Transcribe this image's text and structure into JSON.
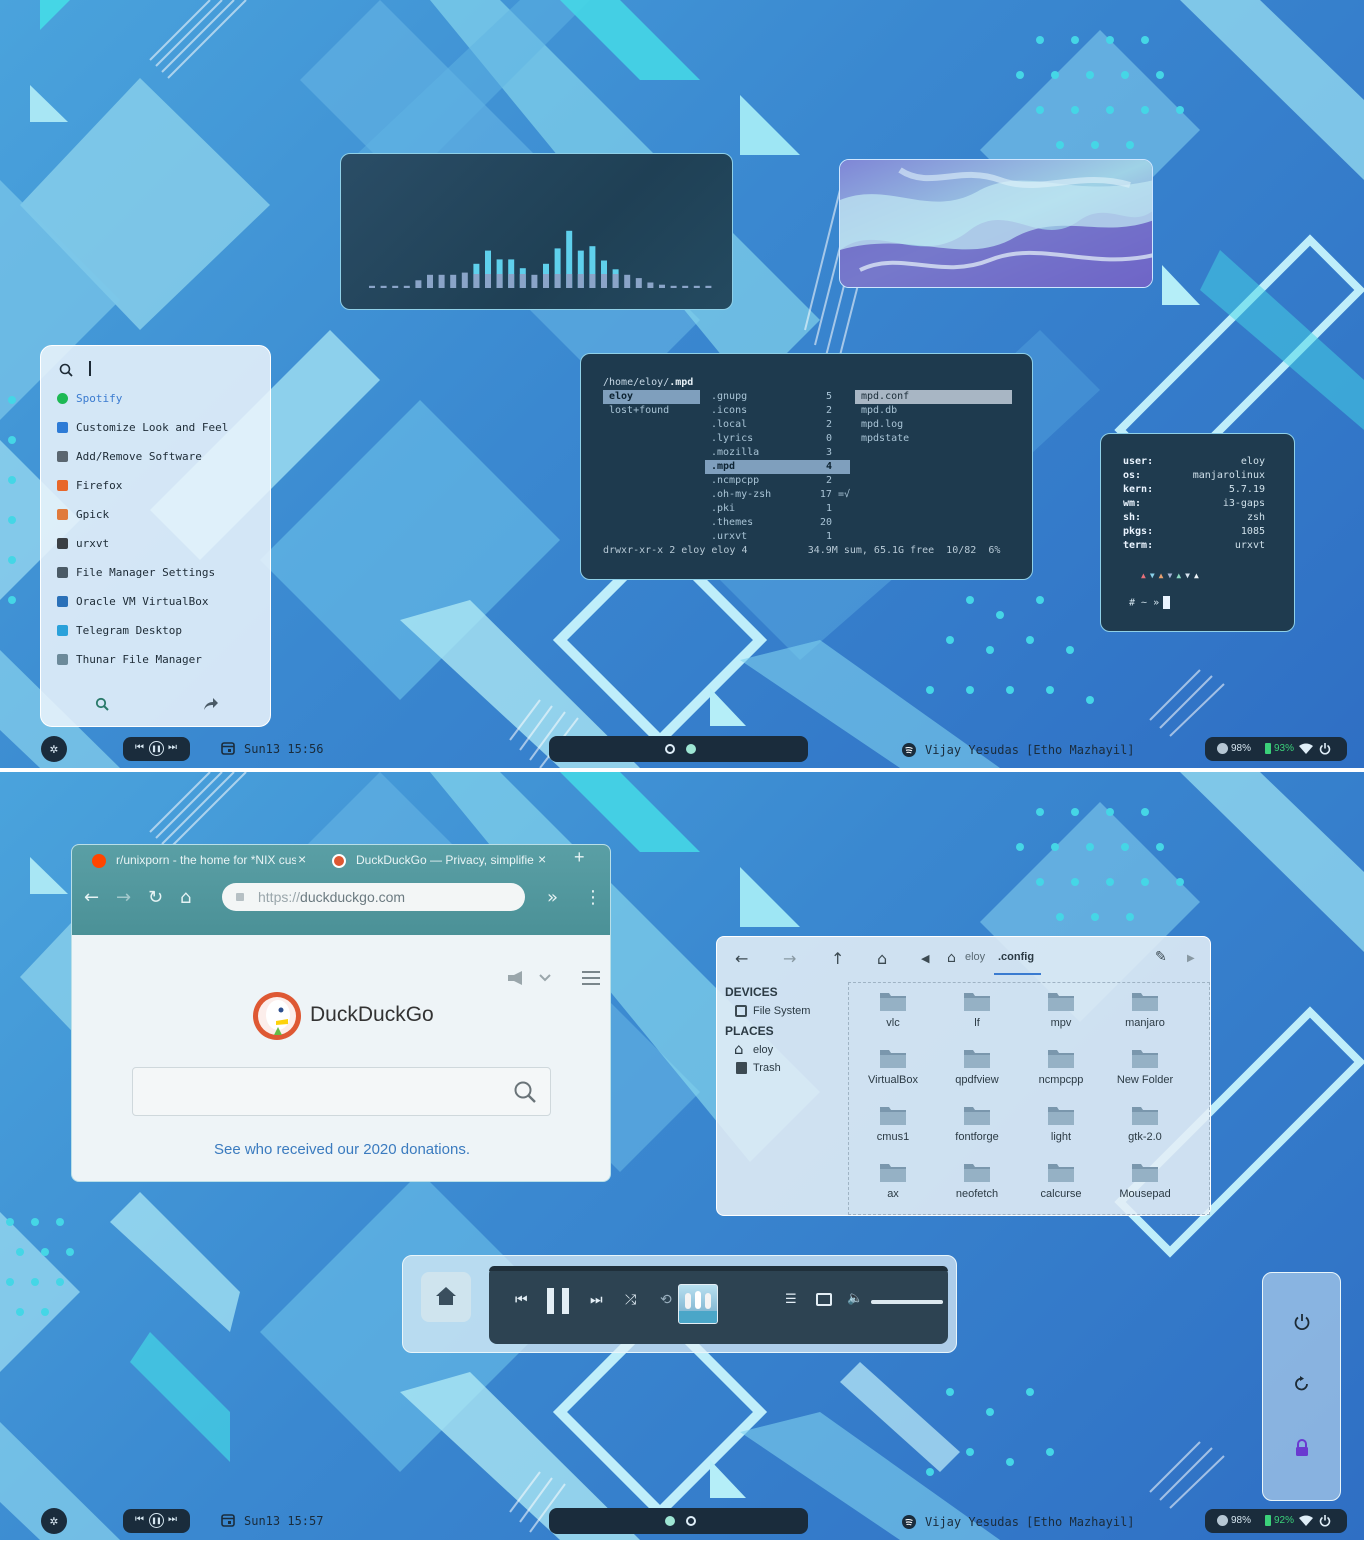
{
  "screen1": {
    "launcher": {
      "search_value": "",
      "items": [
        {
          "label": "Spotify",
          "icon": "spotify-icon",
          "color": "#1db954"
        },
        {
          "label": "Customize Look and Feel",
          "icon": "settings-icon",
          "color": "#2d7bd6"
        },
        {
          "label": "Add/Remove Software",
          "icon": "package-icon",
          "color": "#5a6670"
        },
        {
          "label": "Firefox",
          "icon": "firefox-icon",
          "color": "#e8672a"
        },
        {
          "label": "Gpick",
          "icon": "color-picker-icon",
          "color": "#e07a3c"
        },
        {
          "label": "urxvt",
          "icon": "terminal-icon",
          "color": "#3a3f44"
        },
        {
          "label": "File Manager Settings",
          "icon": "file-manager-icon",
          "color": "#4a5a66"
        },
        {
          "label": "Oracle VM VirtualBox",
          "icon": "virtualbox-icon",
          "color": "#2a70b8"
        },
        {
          "label": "Telegram Desktop",
          "icon": "telegram-icon",
          "color": "#2aa1da"
        },
        {
          "label": "Thunar File Manager",
          "icon": "folder-icon",
          "color": "#6c8a9a"
        }
      ]
    },
    "visualizer": {
      "bar_levels": [
        0.02,
        0.02,
        0.02,
        0.02,
        0.07,
        0.12,
        0.12,
        0.12,
        0.14,
        0.22,
        0.34,
        0.26,
        0.26,
        0.18,
        0.12,
        0.22,
        0.36,
        0.52,
        0.34,
        0.38,
        0.25,
        0.17,
        0.12,
        0.09,
        0.05,
        0.03,
        0.02,
        0.02,
        0.02,
        0.02
      ]
    },
    "ranger": {
      "path_prefix": "/home/eloy/",
      "path_current": ".mpd",
      "col1": [
        {
          "name": "eloy",
          "selected": true
        },
        {
          "name": "lost+found",
          "selected": false
        }
      ],
      "col2": [
        {
          "name": ".gnupg",
          "count": "5"
        },
        {
          "name": ".icons",
          "count": "2"
        },
        {
          "name": ".local",
          "count": "2"
        },
        {
          "name": ".lyrics",
          "count": "0"
        },
        {
          "name": ".mozilla",
          "count": "3"
        },
        {
          "name": ".mpd",
          "count": "4",
          "selected": true
        },
        {
          "name": ".ncmpcpp",
          "count": "2"
        },
        {
          "name": ".oh-my-zsh",
          "count": "17 =√"
        },
        {
          "name": ".pki",
          "count": "1"
        },
        {
          "name": ".themes",
          "count": "20"
        },
        {
          "name": ".urxvt",
          "count": "1"
        }
      ],
      "col3": [
        {
          "name": "mpd.conf",
          "selected": true
        },
        {
          "name": "mpd.db"
        },
        {
          "name": "mpd.log"
        },
        {
          "name": "mpdstate"
        }
      ],
      "status": "drwxr-xr-x 2 eloy eloy 4          34.9M sum, 65.1G free  10/82  6%"
    },
    "sysinfo": {
      "rows": [
        {
          "key": "user:",
          "value": "eloy"
        },
        {
          "key": "os:",
          "value": "manjarolinux"
        },
        {
          "key": "kern:",
          "value": "5.7.19"
        },
        {
          "key": "wm:",
          "value": "i3-gaps"
        },
        {
          "key": "sh:",
          "value": "zsh"
        },
        {
          "key": "pkgs:",
          "value": "1085"
        },
        {
          "key": "term:",
          "value": "urxvt"
        }
      ],
      "triangles": "▲▼▲▼▲▼▲",
      "prompt": "# ~ »"
    },
    "bar": {
      "date": "Sun13",
      "time": "15:56",
      "now_playing": "Vijay Yesudas [Etho Mazhayil]",
      "brightness": "98%",
      "battery": "93%",
      "workspace_active": 1
    }
  },
  "screen2": {
    "browser": {
      "tabs": [
        {
          "title": "r/unixporn - the home for *NIX customization!",
          "icon": "reddit-icon"
        },
        {
          "title": "DuckDuckGo — Privacy, simplified.",
          "icon": "duckduckgo-icon"
        }
      ],
      "new_tab": "+",
      "url_scheme": "https://",
      "url_host": "duckduckgo.com",
      "logo_text": "DuckDuckGo",
      "search_value": "",
      "donation_link": "See who received our 2020 donations."
    },
    "file_manager": {
      "breadcrumb": [
        "eloy",
        ".config"
      ],
      "devices_header": "DEVICES",
      "devices": [
        "File System"
      ],
      "places_header": "PLACES",
      "places": [
        "eloy",
        "Trash"
      ],
      "folders": [
        "vlc",
        "lf",
        "mpv",
        "manjaro",
        "VirtualBox",
        "qpdfview",
        "ncmpcpp",
        "New Folder",
        "cmus1",
        "fontforge",
        "light",
        "gtk-2.0",
        "ax",
        "neofetch",
        "calcurse",
        "Mousepad"
      ]
    },
    "player": {
      "progress": 0.0,
      "volume": 1.0
    },
    "power_menu": [
      "power-icon",
      "restart-icon",
      "lock-icon"
    ],
    "bar": {
      "date": "Sun13",
      "time": "15:57",
      "now_playing": "Vijay Yesudas [Etho Mazhayil]",
      "brightness": "98%",
      "battery": "92%",
      "workspace_active": 2
    }
  },
  "colors": {
    "accent": "#44d3e6",
    "bar_bg": "#1a2c3c",
    "battery": "#3bd17a"
  }
}
